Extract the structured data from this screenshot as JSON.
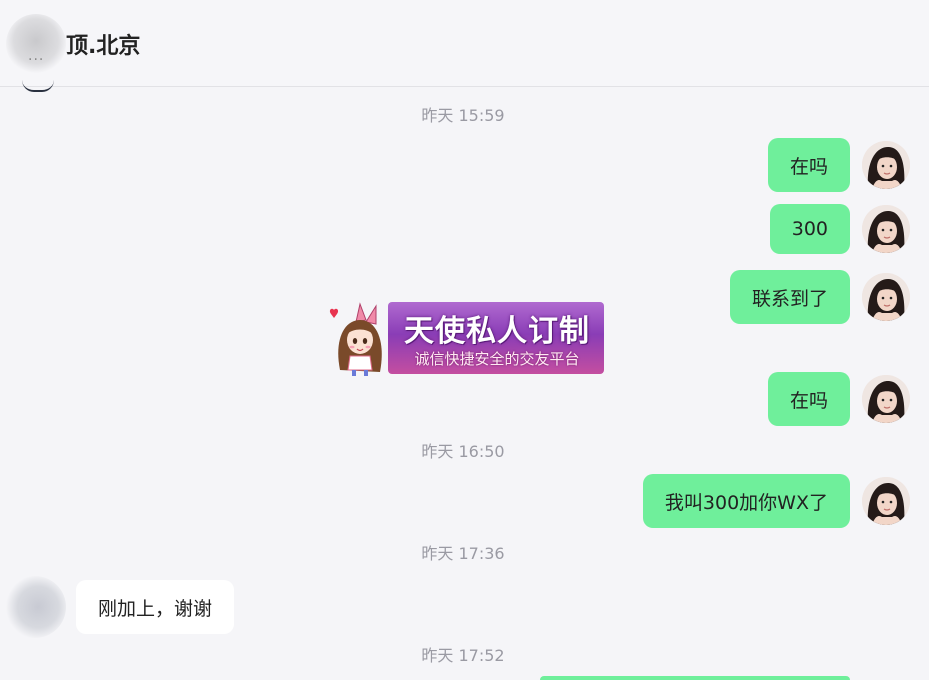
{
  "header": {
    "title": "顶.北京",
    "blurred_prefix": "..."
  },
  "timestamps": {
    "t1": "昨天 15:59",
    "t2": "昨天 16:50",
    "t3": "昨天 17:36",
    "t4": "昨天 17:52"
  },
  "messages": [
    {
      "direction": "out",
      "text": "在吗"
    },
    {
      "direction": "out",
      "text": "300"
    },
    {
      "direction": "out",
      "text": "联系到了"
    },
    {
      "direction": "out",
      "text": "在吗"
    },
    {
      "direction": "out",
      "text": "我叫300加你WX了"
    },
    {
      "direction": "in",
      "text": "刚加上，谢谢"
    }
  ],
  "ad": {
    "title": "天使私人订制",
    "subtitle": "诚信快捷安全的交友平台"
  },
  "colors": {
    "outgoing_bubble": "#6fef9b",
    "incoming_bubble": "#ffffff",
    "background": "#f5f5f8",
    "timestamp": "#9a9aa3"
  }
}
